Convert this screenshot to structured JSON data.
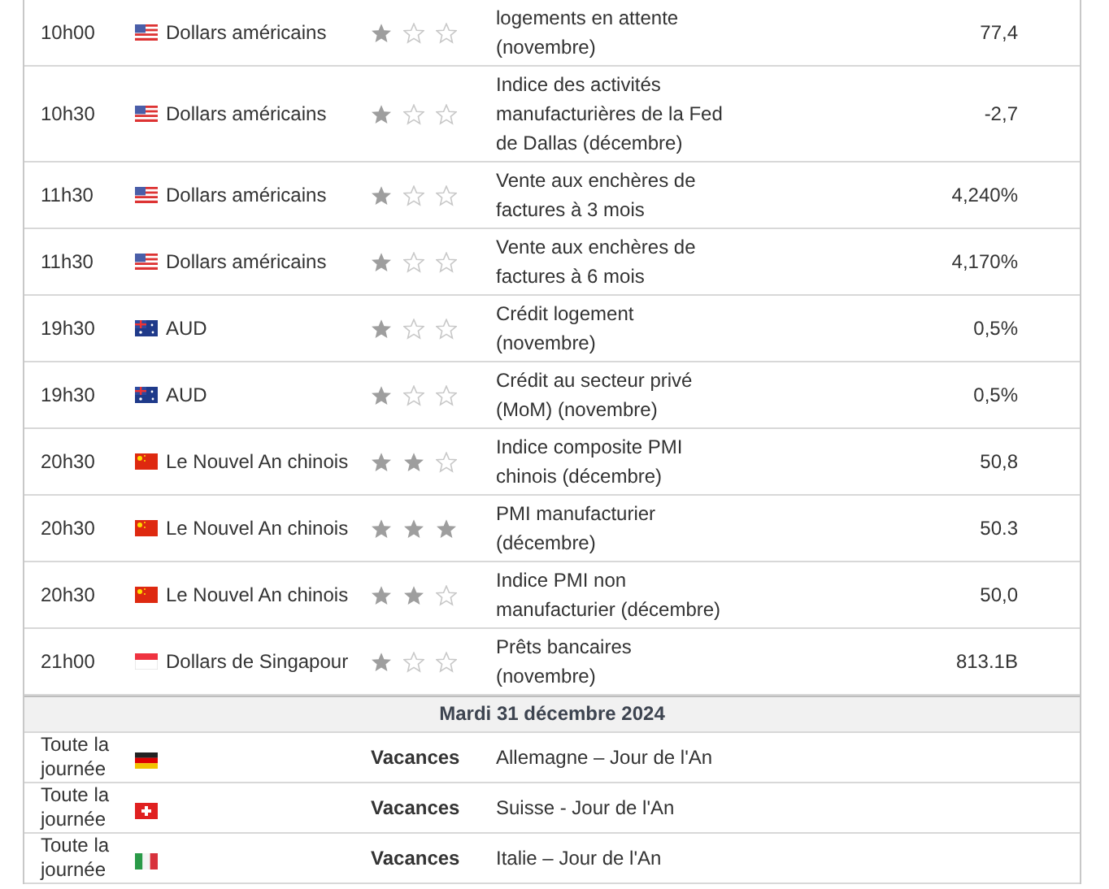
{
  "rows": [
    {
      "kind": "event",
      "time": "10h00",
      "flag": {
        "kind": "us"
      },
      "currency": "Dollars américains",
      "stars": 1,
      "event": "logements en attente (novembre)",
      "value": "77,4"
    },
    {
      "kind": "event",
      "time": "10h30",
      "flag": {
        "kind": "us"
      },
      "currency": "Dollars américains",
      "stars": 1,
      "event": "Indice des activités manufacturières de la Fed de Dallas (décembre)",
      "value": "-2,7"
    },
    {
      "kind": "event",
      "time": "11h30",
      "flag": {
        "kind": "us"
      },
      "currency": "Dollars américains",
      "stars": 1,
      "event": "Vente aux enchères de factures à 3 mois",
      "value": "4,240%"
    },
    {
      "kind": "event",
      "time": "11h30",
      "flag": {
        "kind": "us"
      },
      "currency": "Dollars américains",
      "stars": 1,
      "event": "Vente aux enchères de factures à 6 mois",
      "value": "4,170%"
    },
    {
      "kind": "event",
      "time": "19h30",
      "flag": {
        "kind": "au"
      },
      "currency": "AUD",
      "stars": 1,
      "event": "Crédit logement (novembre)",
      "value": "0,5%"
    },
    {
      "kind": "event",
      "time": "19h30",
      "flag": {
        "kind": "au"
      },
      "currency": "AUD",
      "stars": 1,
      "event": "Crédit au secteur privé (MoM) (novembre)",
      "value": "0,5%"
    },
    {
      "kind": "event",
      "time": "20h30",
      "flag": {
        "kind": "cn"
      },
      "currency": "Le Nouvel An chinois",
      "stars": 2,
      "event": "Indice composite PMI chinois (décembre)",
      "value": "50,8"
    },
    {
      "kind": "event",
      "time": "20h30",
      "flag": {
        "kind": "cn"
      },
      "currency": "Le Nouvel An chinois",
      "stars": 3,
      "event": "PMI manufacturier (décembre)",
      "value": "50.3"
    },
    {
      "kind": "event",
      "time": "20h30",
      "flag": {
        "kind": "cn"
      },
      "currency": "Le Nouvel An chinois",
      "stars": 2,
      "event": "Indice PMI non manufacturier (décembre)",
      "value": "50,0"
    },
    {
      "kind": "event",
      "time": "21h00",
      "flag": {
        "kind": "sg"
      },
      "currency": "Dollars de Singapour",
      "stars": 1,
      "event": "Prêts bancaires (novembre)",
      "value": "813.1B"
    },
    {
      "kind": "date_header",
      "label": "Mardi 31 décembre 2024"
    },
    {
      "kind": "holiday",
      "time": "Toute la journée",
      "flag": {
        "kind": "de"
      },
      "label": "Vacances",
      "event": "Allemagne – Jour de l'An"
    },
    {
      "kind": "holiday",
      "time": "Toute la journée",
      "flag": {
        "kind": "ch"
      },
      "label": "Vacances",
      "event": "Suisse - Jour de l'An"
    },
    {
      "kind": "holiday",
      "time": "Toute la journée",
      "flag": {
        "kind": "it"
      },
      "label": "Vacances",
      "event": "Italie – Jour de l'An"
    }
  ]
}
